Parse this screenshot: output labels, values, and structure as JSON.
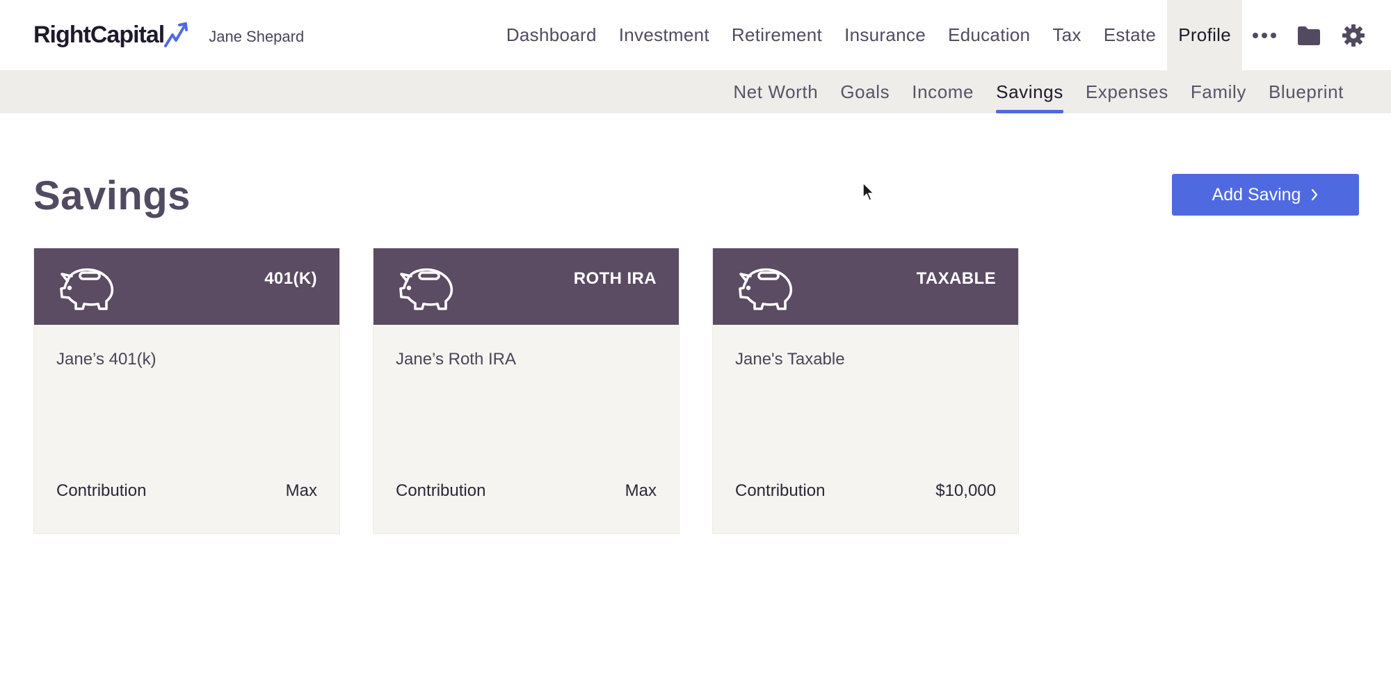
{
  "brand": {
    "name": "RightCapital",
    "user": "Jane Shepard",
    "accent_color": "#4f6ae0"
  },
  "main_nav": {
    "items": [
      {
        "label": "Dashboard"
      },
      {
        "label": "Investment"
      },
      {
        "label": "Retirement"
      },
      {
        "label": "Insurance"
      },
      {
        "label": "Education"
      },
      {
        "label": "Tax"
      },
      {
        "label": "Estate"
      },
      {
        "label": "Profile"
      }
    ],
    "active": "Profile",
    "icons": [
      "more-icon",
      "folder-icon",
      "gear-icon"
    ]
  },
  "sub_nav": {
    "items": [
      {
        "label": "Net Worth"
      },
      {
        "label": "Goals"
      },
      {
        "label": "Income"
      },
      {
        "label": "Savings"
      },
      {
        "label": "Expenses"
      },
      {
        "label": "Family"
      },
      {
        "label": "Blueprint"
      }
    ],
    "active": "Savings"
  },
  "page": {
    "title": "Savings",
    "add_button_label": "Add Saving",
    "add_button_icon": "chevron-right-icon"
  },
  "cards": [
    {
      "type": "401(K)",
      "name": "Jane’s 401(k)",
      "contribution_label": "Contribution",
      "contribution_value": "Max",
      "icon": "piggy-bank-icon"
    },
    {
      "type": "ROTH IRA",
      "name": "Jane’s Roth IRA",
      "contribution_label": "Contribution",
      "contribution_value": "Max",
      "icon": "piggy-bank-icon"
    },
    {
      "type": "TAXABLE",
      "name": "Jane's Taxable",
      "contribution_label": "Contribution",
      "contribution_value": "$10,000",
      "icon": "piggy-bank-icon"
    }
  ],
  "colors": {
    "card_header": "#5b4b63",
    "card_body": "#f6f4f0",
    "subnav_bg": "#eeede9",
    "button": "#4f6ae0"
  }
}
